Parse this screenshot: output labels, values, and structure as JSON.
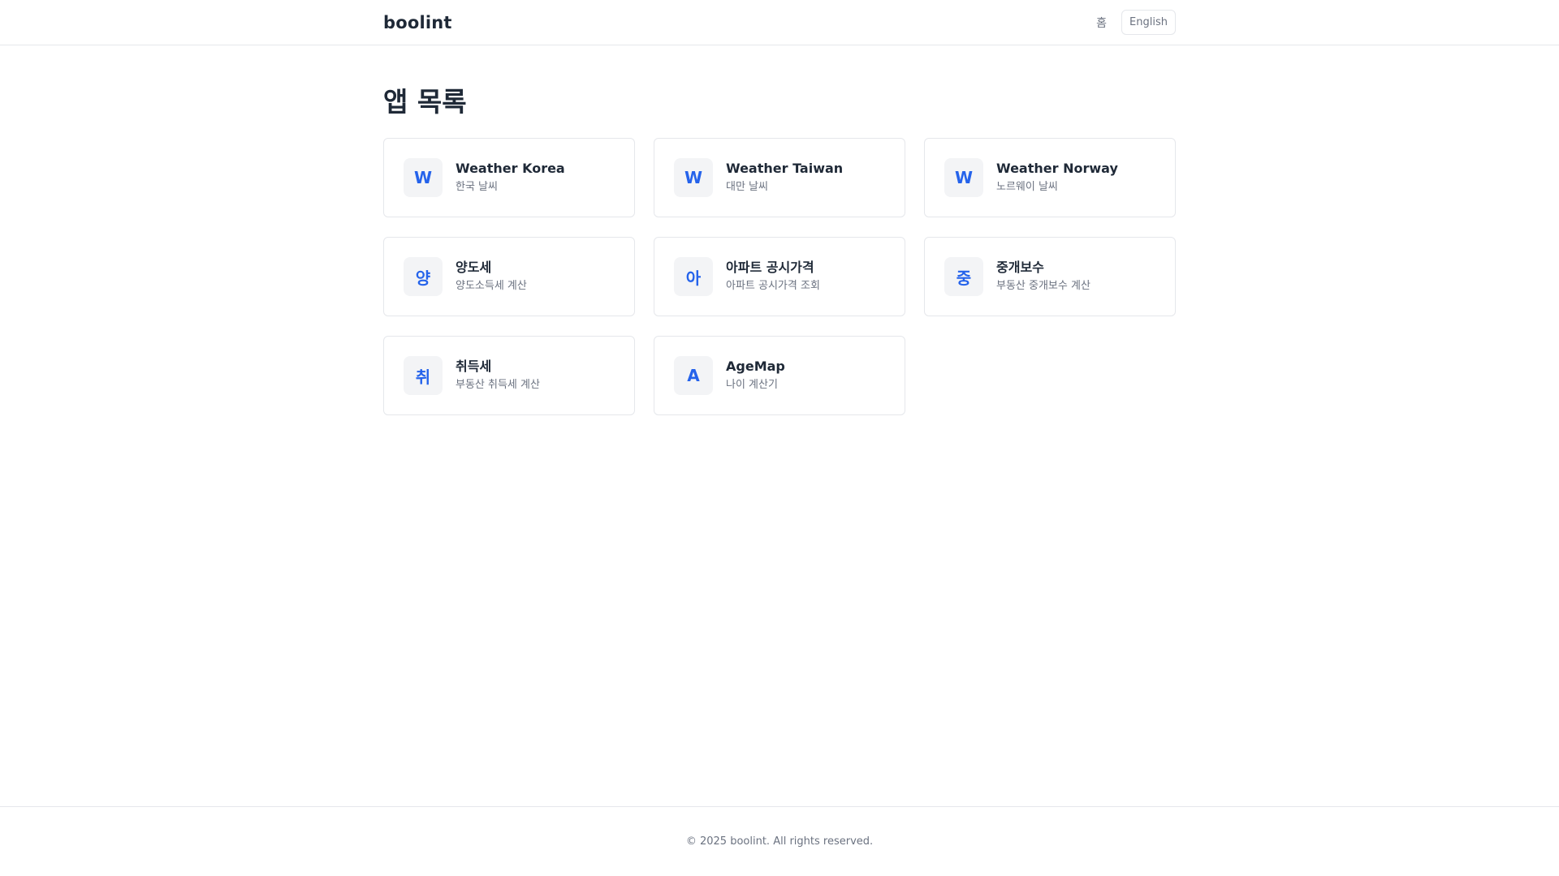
{
  "header": {
    "brand": "boolint",
    "nav_home": "홈",
    "language_button": "English"
  },
  "main": {
    "title": "앱 목록",
    "apps": [
      {
        "icon_letter": "W",
        "title": "Weather Korea",
        "subtitle": "한국 날씨"
      },
      {
        "icon_letter": "W",
        "title": "Weather Taiwan",
        "subtitle": "대만 날씨"
      },
      {
        "icon_letter": "W",
        "title": "Weather Norway",
        "subtitle": "노르웨이 날씨"
      },
      {
        "icon_letter": "양",
        "title": "양도세",
        "subtitle": "양도소득세 계산"
      },
      {
        "icon_letter": "아",
        "title": "아파트 공시가격",
        "subtitle": "아파트 공시가격 조회"
      },
      {
        "icon_letter": "중",
        "title": "중개보수",
        "subtitle": "부동산 중개보수 계산"
      },
      {
        "icon_letter": "취",
        "title": "취득세",
        "subtitle": "부동산 취득세 계산"
      },
      {
        "icon_letter": "A",
        "title": "AgeMap",
        "subtitle": "나이 계산기"
      }
    ]
  },
  "footer": {
    "copyright": "© 2025 boolint. All rights reserved."
  },
  "colors": {
    "accent": "#2563eb",
    "text_primary": "#1f2937",
    "text_secondary": "#6b7280",
    "border": "#e5e7eb",
    "icon_bg": "#f3f4f6"
  }
}
